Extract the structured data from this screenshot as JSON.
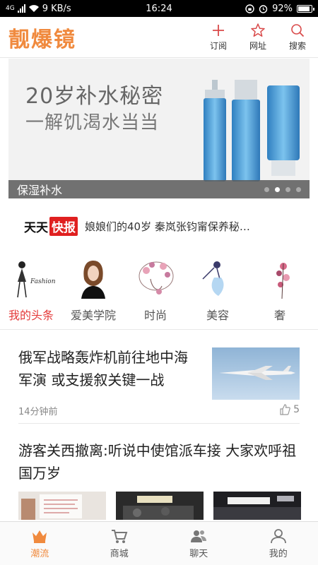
{
  "status_bar": {
    "network": "4G",
    "speed": "9 KB/s",
    "time": "16:24",
    "battery": "92%",
    "battery_level": 0.92
  },
  "header": {
    "logo": "靓爆镜",
    "actions": [
      {
        "label": "订阅",
        "icon": "plus-icon"
      },
      {
        "label": "网址",
        "icon": "star-icon"
      },
      {
        "label": "搜索",
        "icon": "search-icon"
      }
    ]
  },
  "banner": {
    "title": "20岁补水秘密",
    "subtitle": "一解饥渴水当当",
    "caption": "保湿补水",
    "slide_count": 4,
    "active_slide": 2
  },
  "ticker": {
    "brand_part1": "天天",
    "brand_part2": "快报",
    "text": "娘娘们的40岁 秦岚张钧甯保养秘…"
  },
  "categories": [
    {
      "label": "我的头条",
      "icon": "fashion-figure-icon",
      "active": true
    },
    {
      "label": "爱美学院",
      "icon": "woman-portrait-icon",
      "active": false
    },
    {
      "label": "时尚",
      "icon": "floral-hair-icon",
      "active": false
    },
    {
      "label": "美容",
      "icon": "dancer-icon",
      "active": false
    },
    {
      "label": "奢",
      "icon": "flower-icon",
      "active": false
    }
  ],
  "articles": [
    {
      "title": "俄军战略轰炸机前往地中海军演 或支援叙关键一战",
      "time": "14分钟前",
      "likes": "5",
      "thumbnail": "jet-image"
    },
    {
      "title": "游客关西撤离:听说中使馆派车接 大家欢呼祖国万岁",
      "thumbnails": [
        "document-photo",
        "mcdonalds-photo",
        "airport-photo"
      ]
    }
  ],
  "bottom_nav": [
    {
      "label": "潮流",
      "icon": "crown-icon",
      "active": true
    },
    {
      "label": "商城",
      "icon": "cart-icon",
      "active": false
    },
    {
      "label": "聊天",
      "icon": "chat-people-icon",
      "active": false
    },
    {
      "label": "我的",
      "icon": "user-icon",
      "active": false
    }
  ],
  "colors": {
    "brand": "#f08a3e",
    "active_category": "#e43a3a",
    "ticker_red": "#e02020"
  }
}
